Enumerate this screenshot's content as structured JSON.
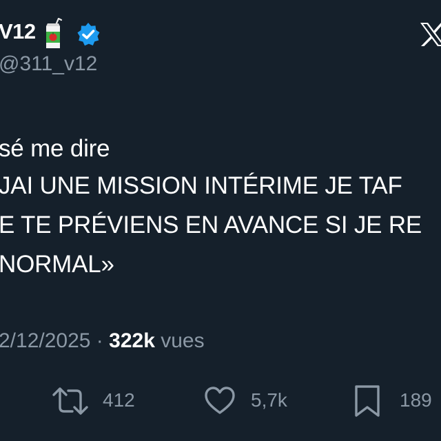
{
  "author": {
    "display_name": "V12",
    "handle": "@311_v12",
    "emoji_icon": "juice-box-icon",
    "verified_icon": "verified-badge-icon"
  },
  "platform_icon": "x-logo-icon",
  "tweet": {
    "lines": [
      "sé me dire",
      "JAI UNE MISSION INTÉRIME JE TAF",
      "E TE PRÉVIENS EN AVANCE SI JE RE",
      "NORMAL»"
    ]
  },
  "meta": {
    "date": "2/12/2025",
    "separator": " · ",
    "views": "322k",
    "views_label": " vues"
  },
  "actions": {
    "retweets": "412",
    "likes": "5,7k",
    "bookmarks": "189"
  },
  "colors": {
    "background": "#15202b",
    "text": "#ffffff",
    "muted": "#8b98a5",
    "verified": "#1d9bf0"
  }
}
